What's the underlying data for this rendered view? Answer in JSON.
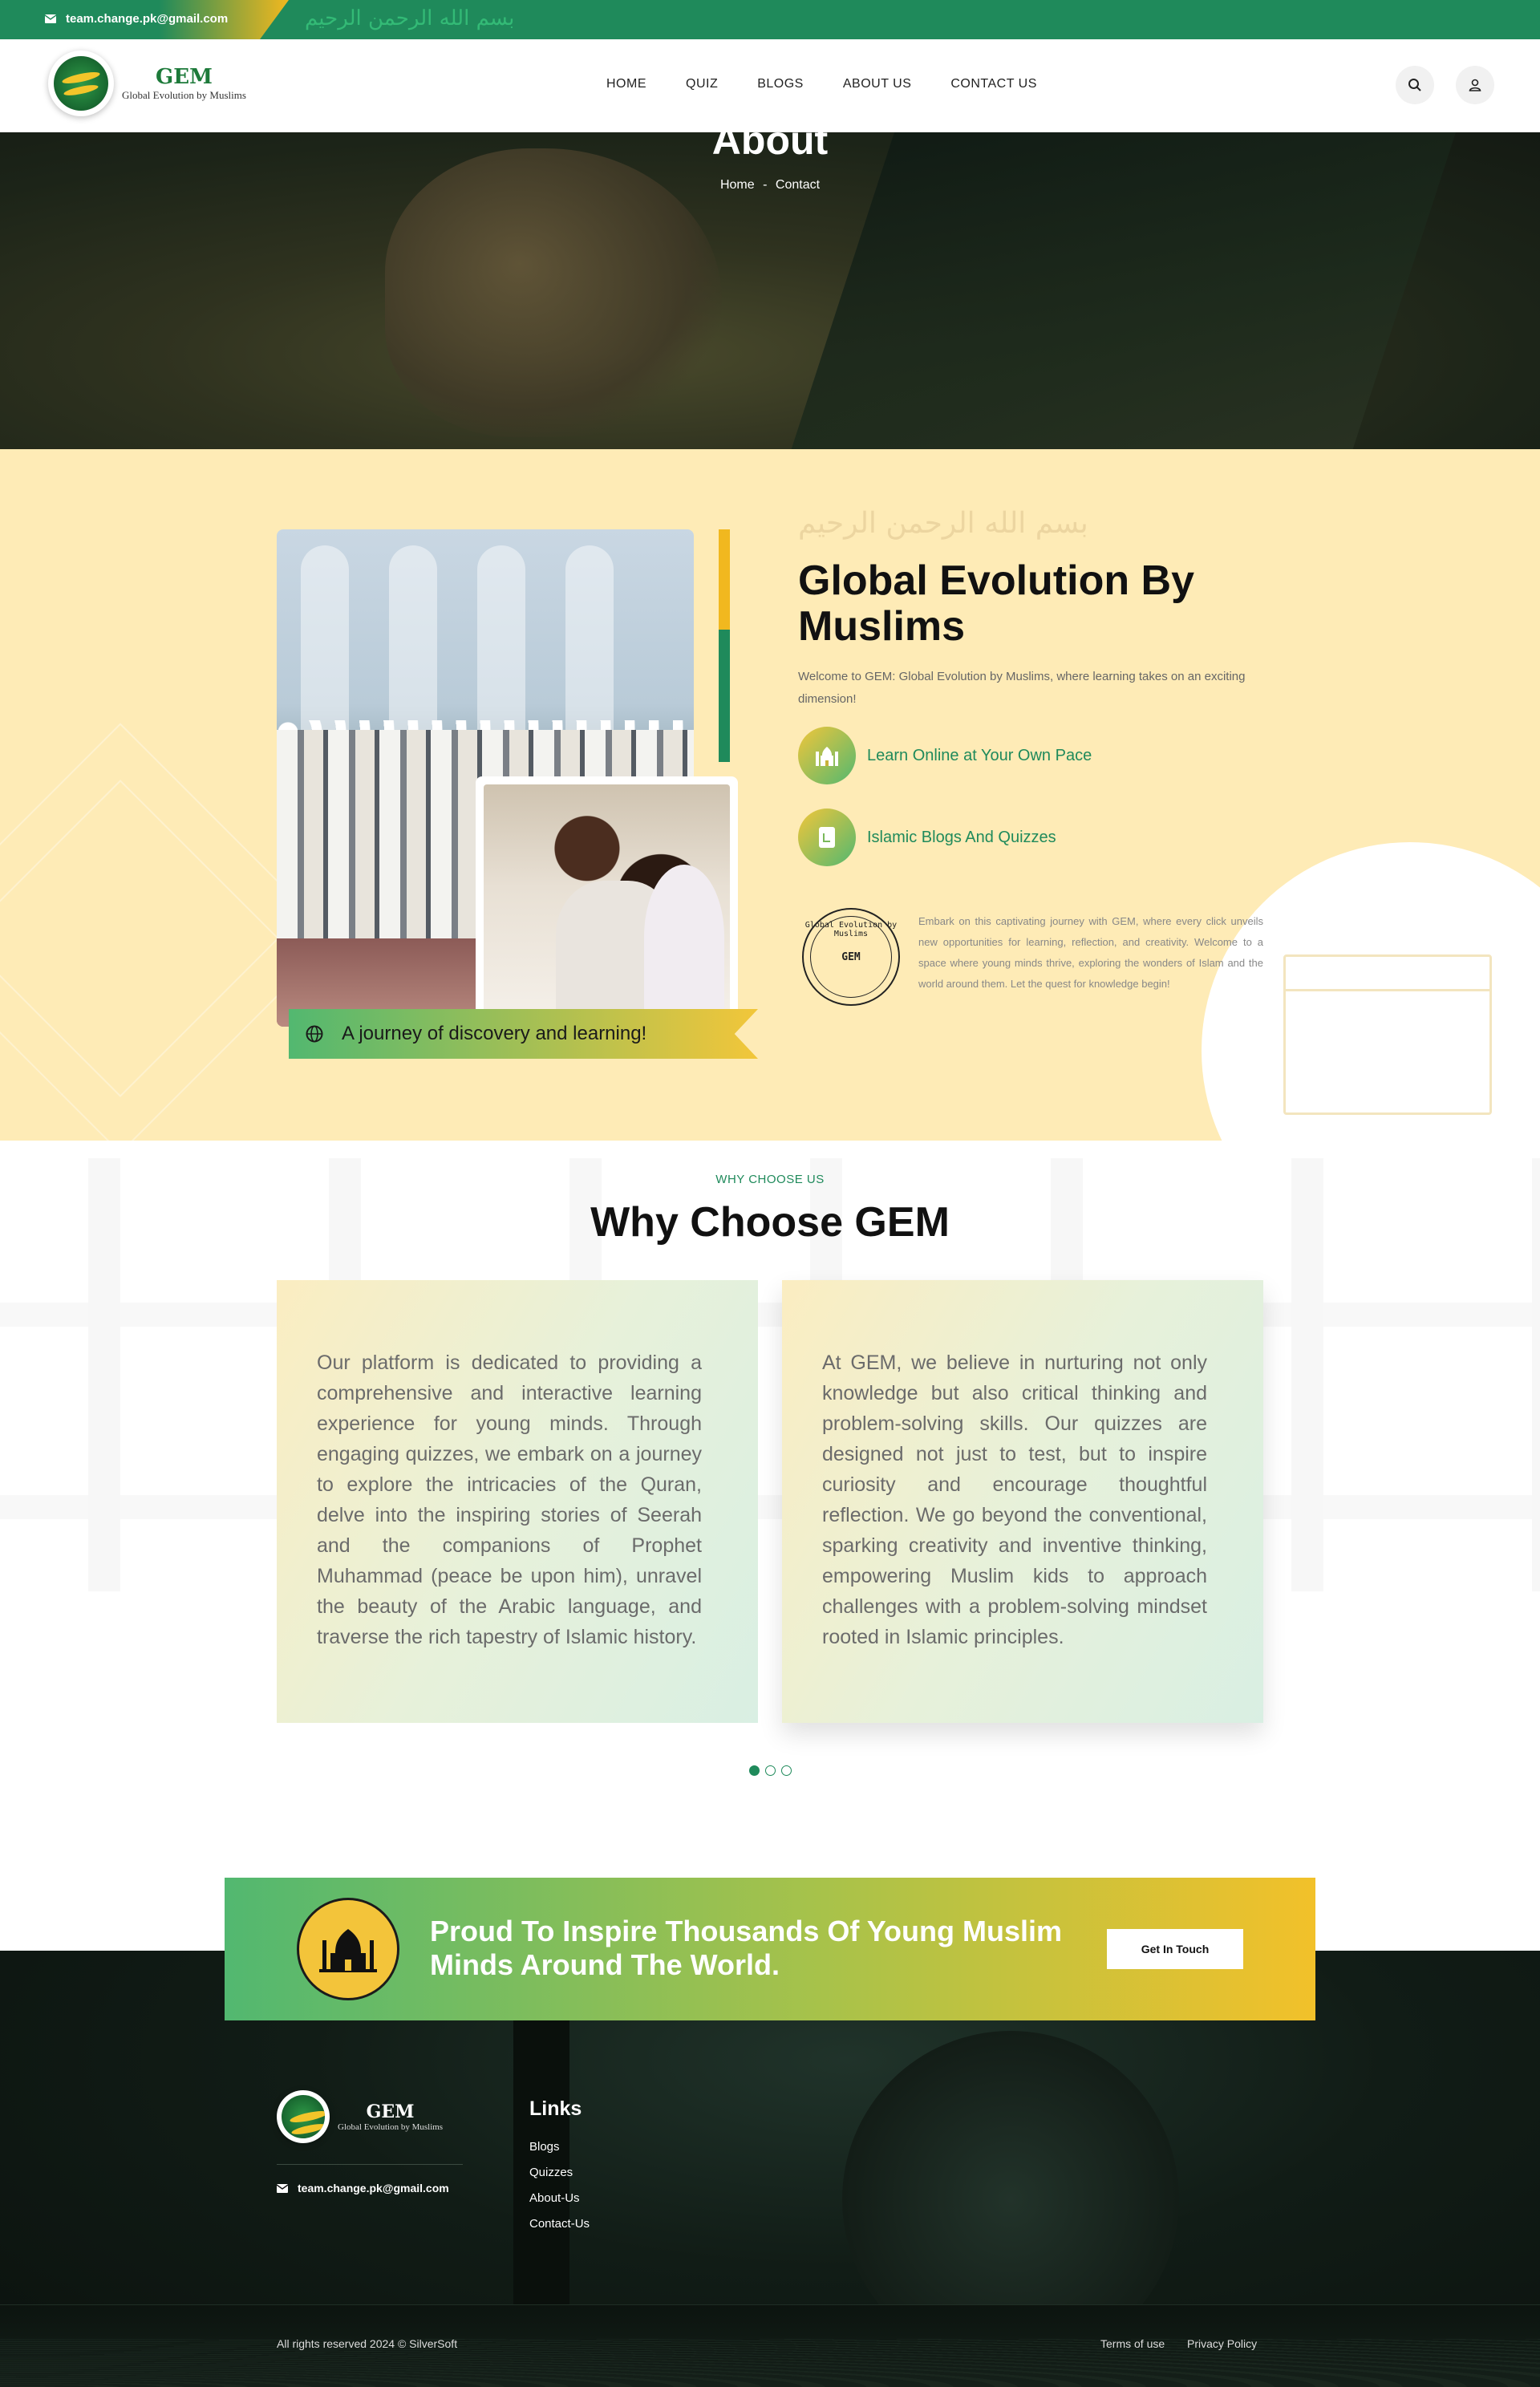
{
  "topbar": {
    "email": "team.change.pk@gmail.com",
    "calligraphy": "بسم الله الرحمن الرحيم"
  },
  "brand": {
    "title": "GEM",
    "subtitle": "Global Evolution by Muslims"
  },
  "nav": {
    "items": [
      "HOME",
      "QUIZ",
      "BLOGS",
      "ABOUT US",
      "CONTACT US"
    ]
  },
  "hero": {
    "title": "About",
    "crumb_home": "Home",
    "crumb_sep": "-",
    "crumb_current": "Contact"
  },
  "about": {
    "calligraphy": "بسم الله الرحمن الرحيم",
    "title": "Global Evolution By Muslims",
    "welcome": "Welcome to GEM: Global Evolution by Muslims, where learning takes on an exciting dimension!",
    "features": [
      "Learn Online at Your Own Pace",
      "Islamic Blogs And Quizzes"
    ],
    "stamp_ring": "Global Evolution by Muslims",
    "stamp_center": "GEM",
    "stamp_text": "Embark on this captivating journey with GEM, where every click unveils new opportunities for learning, reflection, and creativity. Welcome to a space where young minds thrive, exploring the wonders of Islam and the world around them. Let the quest for knowledge begin!",
    "ribbon": "A journey of discovery and learning!"
  },
  "why": {
    "kicker": "WHY CHOOSE US",
    "title": "Why Choose GEM",
    "cards": [
      "Our platform is dedicated to providing a comprehensive and interactive learning experience for young minds. Through engaging quizzes, we embark on a journey to explore the intricacies of the Quran, delve into the inspiring stories of Seerah and the companions of Prophet Muhammad (peace be upon him), unravel the beauty of the Arabic language, and traverse the rich tapestry of Islamic history.",
      "At GEM, we believe in nurturing not only knowledge but also critical thinking and problem-solving skills. Our quizzes are designed not just to test, but to inspire curiosity and encourage thoughtful reflection. We go beyond the conventional, sparking creativity and inventive thinking, empowering Muslim kids to approach challenges with a problem-solving mindset rooted in Islamic principles."
    ]
  },
  "cta": {
    "text": "Proud To Inspire Thousands Of Young Muslim Minds Around The World.",
    "button": "Get In Touch"
  },
  "footer": {
    "email": "team.change.pk@gmail.com",
    "links_title": "Links",
    "links": [
      "Blogs",
      "Quizzes",
      "About-Us",
      "Contact-Us"
    ],
    "copyright": "All rights reserved 2024 © SilverSoft",
    "terms": "Terms of use",
    "privacy": "Privacy Policy"
  },
  "colors": {
    "brand_green": "#1f8a5b",
    "brand_yellow": "#f1b81f",
    "cream": "#feebb6"
  }
}
